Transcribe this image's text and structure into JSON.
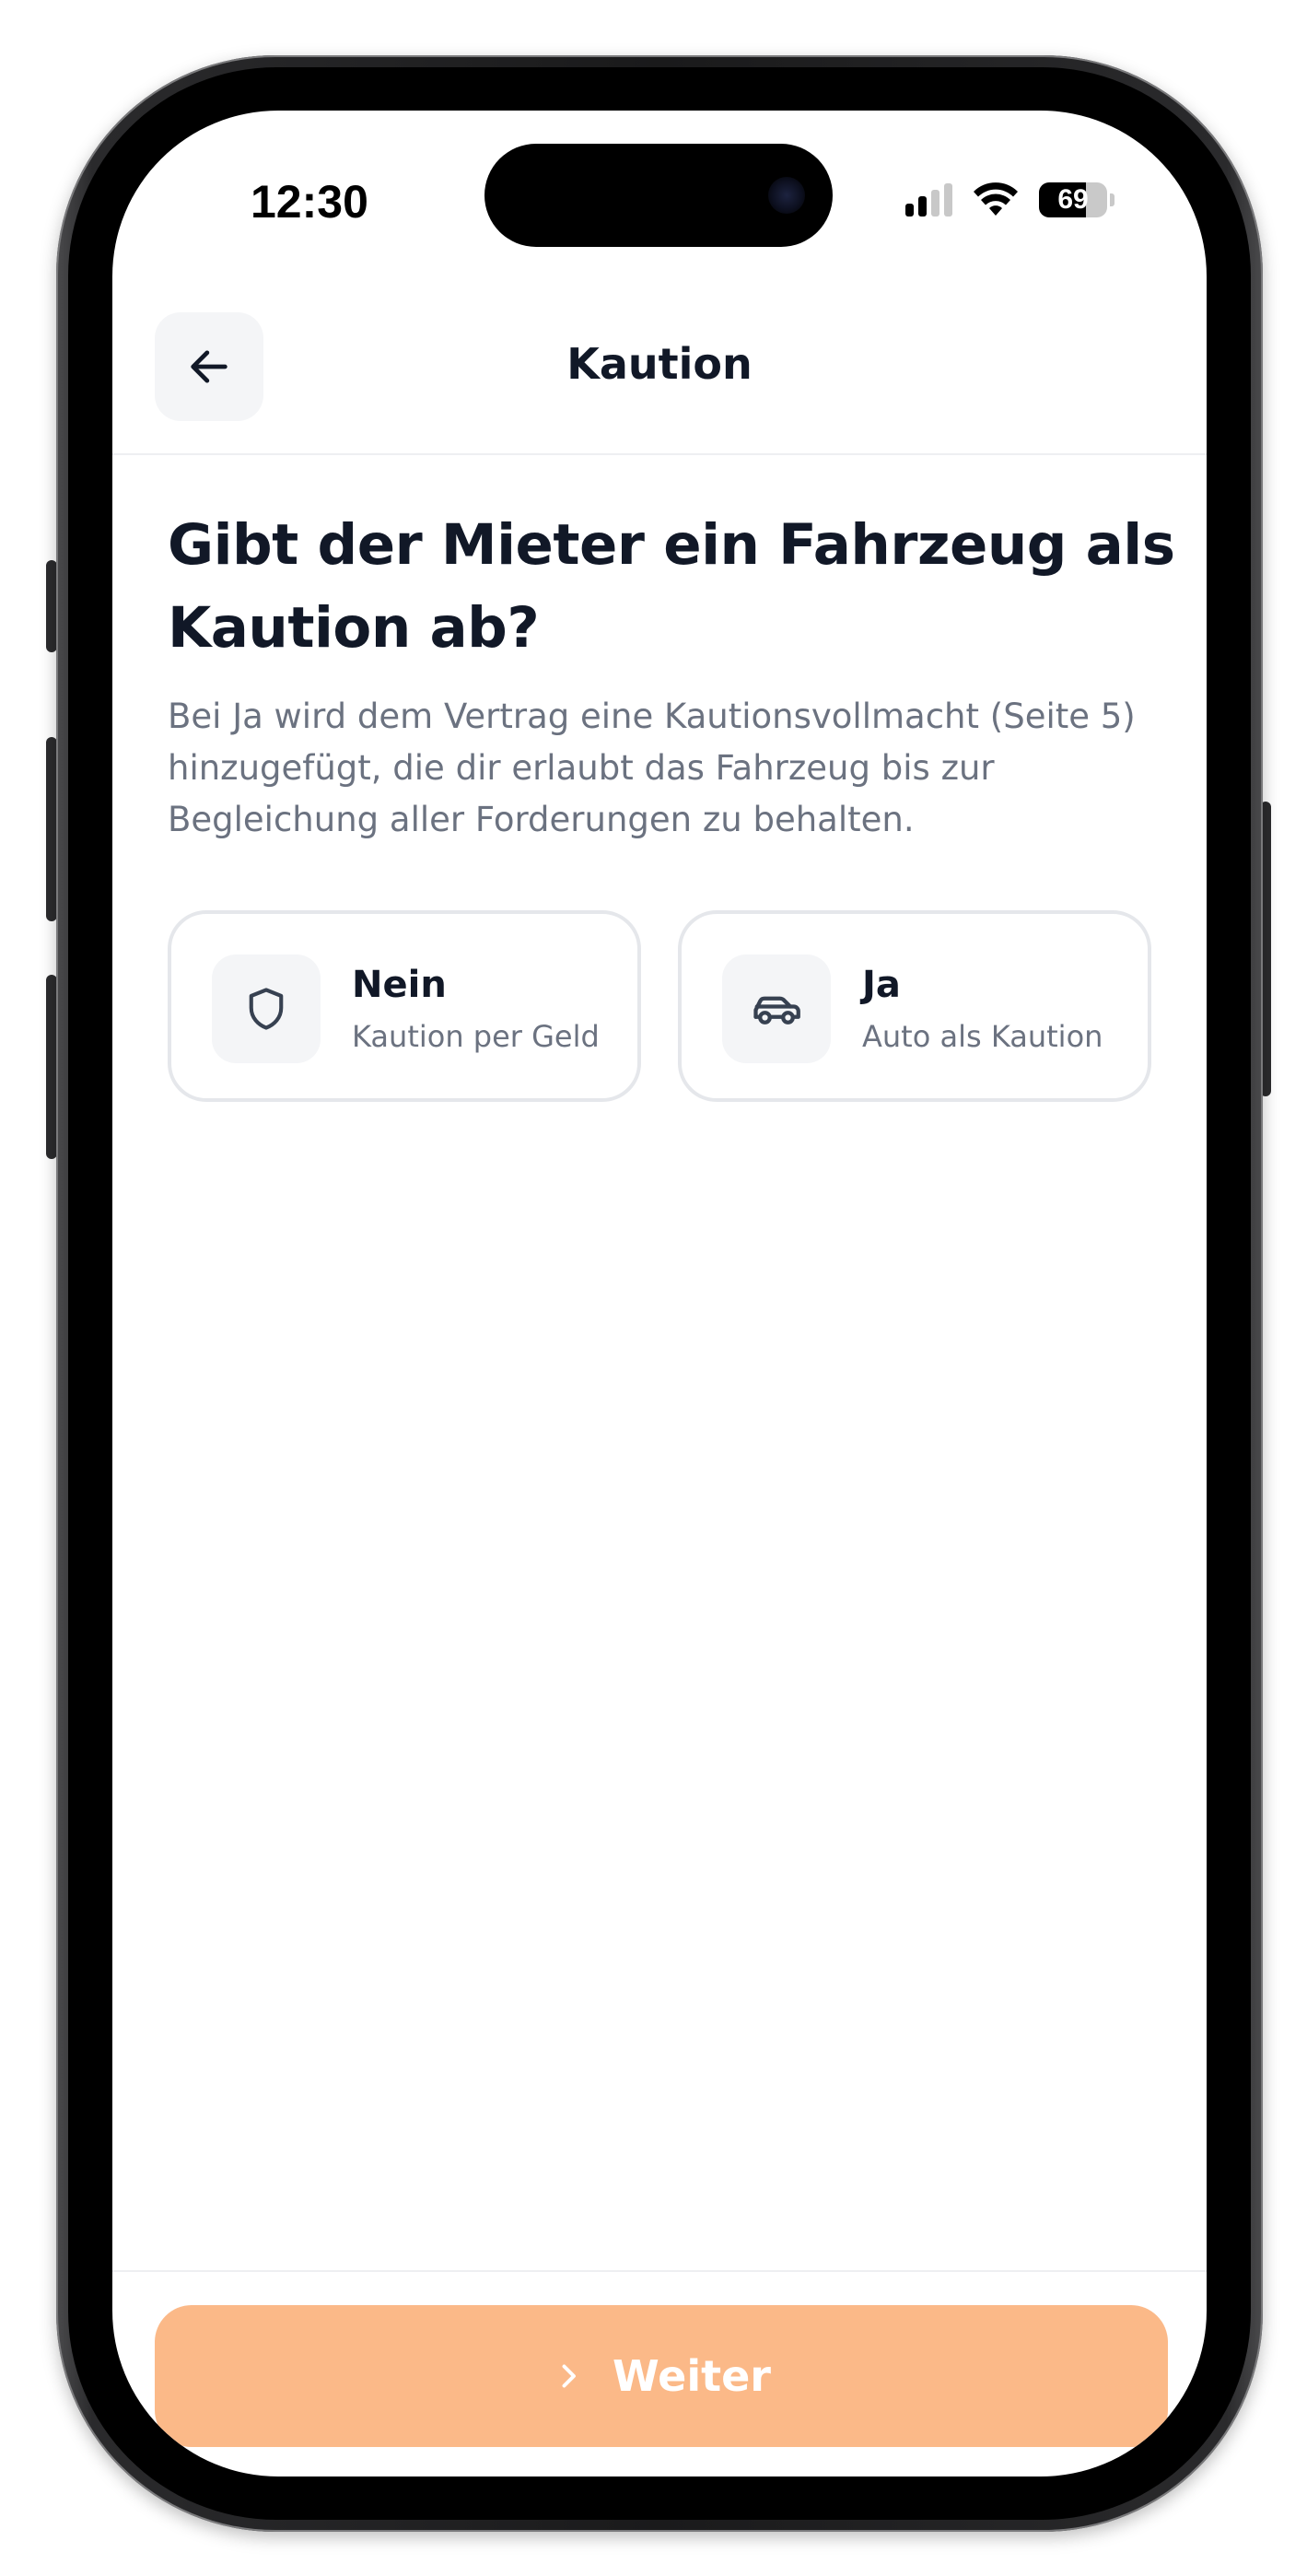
{
  "status_bar": {
    "time": "12:30",
    "battery_level": "69",
    "battery_fraction": 0.69,
    "signal_bars_active": 2,
    "signal_bars_total": 4
  },
  "header": {
    "title": "Kaution",
    "back_icon": "arrow-left-icon"
  },
  "main": {
    "question": "Gibt der Mieter ein Fahrzeug als Kaution ab?",
    "description": "Bei Ja wird dem Vertrag eine Kautionsvollmacht (Seite 5) hinzugefügt, die dir erlaubt das Fahrzeug bis zur Begleichung aller Forderungen zu behalten.",
    "options": [
      {
        "title": "Nein",
        "subtitle": "Kaution per Geld",
        "icon": "shield-icon"
      },
      {
        "title": "Ja",
        "subtitle": "Auto als Kaution",
        "icon": "car-icon"
      }
    ]
  },
  "footer": {
    "next_label": "Weiter",
    "next_icon": "chevron-right-icon",
    "next_color": "#fbb988"
  },
  "colors": {
    "text_primary": "#111827",
    "text_secondary": "#6b7280",
    "icon_bg": "#f4f5f7",
    "border": "#e5e7eb"
  }
}
